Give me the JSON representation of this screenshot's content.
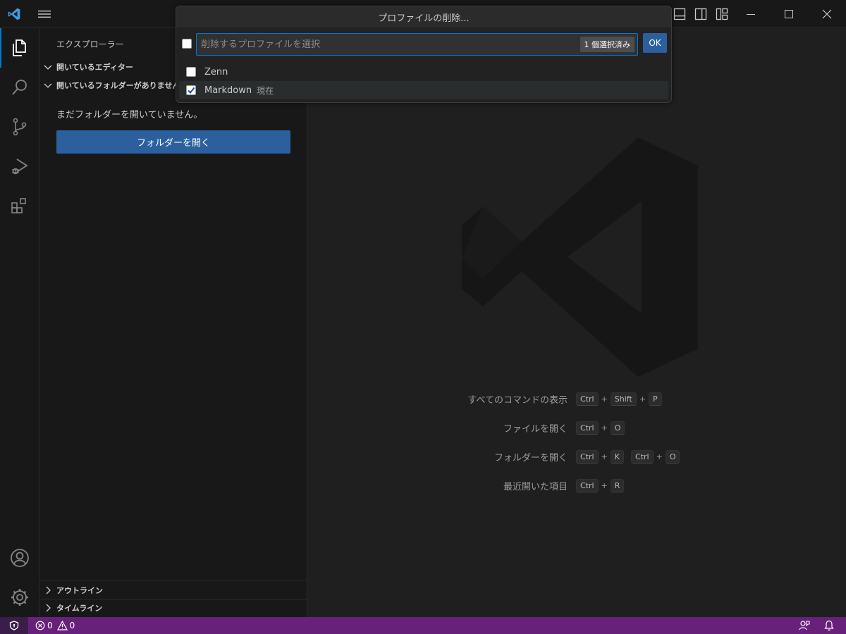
{
  "titlebar": {
    "icons": [
      "vscode-logo",
      "menu-hamburger",
      "toggle-panel",
      "toggle-secondary-sidebar",
      "customize-layout",
      "minimize",
      "maximize",
      "close"
    ]
  },
  "activitybar": {
    "items": [
      "explorer-icon",
      "search-icon",
      "source-control-icon",
      "run-debug-icon",
      "extensions-icon"
    ],
    "bottom": [
      "accounts-icon",
      "manage-gear-icon"
    ]
  },
  "sidebar": {
    "title": "エクスプローラー",
    "open_editors": "開いているエディター",
    "no_folder": "開いているフォルダーがありません",
    "empty_message": "まだフォルダーを開いていません。",
    "open_folder_button": "フォルダーを開く",
    "outline": "アウトライン",
    "timeline": "タイムライン"
  },
  "quickpick": {
    "title": "プロファイルの削除...",
    "placeholder": "削除するプロファイルを選択",
    "selected_count": "1 個選択済み",
    "ok_label": "OK",
    "items": [
      {
        "label": "Zenn",
        "description": "",
        "checked": false
      },
      {
        "label": "Markdown",
        "description": "現在",
        "checked": true
      }
    ]
  },
  "shortcuts": [
    {
      "label": "すべてのコマンドの表示",
      "keys": [
        [
          "Ctrl",
          "Shift",
          "P"
        ]
      ]
    },
    {
      "label": "ファイルを開く",
      "keys": [
        [
          "Ctrl",
          "O"
        ]
      ]
    },
    {
      "label": "フォルダーを開く",
      "keys": [
        [
          "Ctrl",
          "K"
        ],
        [
          "Ctrl",
          "O"
        ]
      ]
    },
    {
      "label": "最近開いた項目",
      "keys": [
        [
          "Ctrl",
          "R"
        ]
      ]
    }
  ],
  "statusbar": {
    "errors": "0",
    "warnings": "0",
    "background_color": "#68217a"
  },
  "colors": {
    "accent": "#0078d4",
    "button": "#2c5f9e"
  }
}
